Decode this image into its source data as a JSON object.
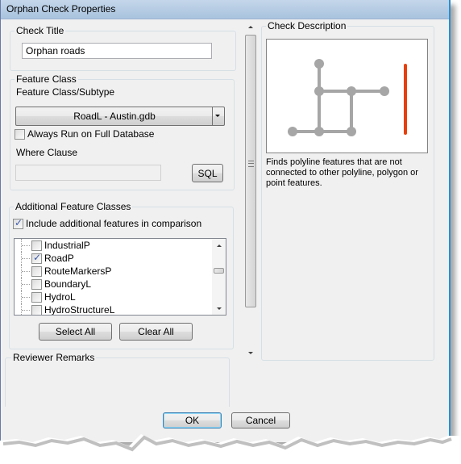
{
  "window": {
    "title": "Orphan Check Properties"
  },
  "check_title": {
    "legend": "Check Title",
    "value": "Orphan roads"
  },
  "feature_class": {
    "legend": "Feature Class",
    "subtype_label": "Feature Class/Subtype",
    "selected": "RoadL -  Austin.gdb",
    "always_run_label": "Always Run on Full Database",
    "always_run_checked": false,
    "where_clause_label": "Where Clause",
    "where_clause_value": "",
    "sql_button": "SQL"
  },
  "additional": {
    "legend": "Additional Feature Classes",
    "include_label": "Include additional features in comparison",
    "include_checked": true,
    "items": [
      {
        "name": "IndustrialP",
        "checked": false
      },
      {
        "name": "RoadP",
        "checked": true
      },
      {
        "name": "RouteMarkersP",
        "checked": false
      },
      {
        "name": "BoundaryL",
        "checked": false
      },
      {
        "name": "HydroL",
        "checked": false
      },
      {
        "name": "HydroStructureL",
        "checked": false
      }
    ],
    "select_all": "Select All",
    "clear_all": "Clear All"
  },
  "reviewer_remarks": {
    "legend": "Reviewer Remarks"
  },
  "description": {
    "legend": "Check Description",
    "text": "Finds polyline features that are not connected to other polyline, polygon or point features.",
    "colors": {
      "network": "#a6a6a6",
      "orphan": "#e8400c"
    }
  },
  "footer": {
    "ok": "OK",
    "cancel": "Cancel"
  }
}
